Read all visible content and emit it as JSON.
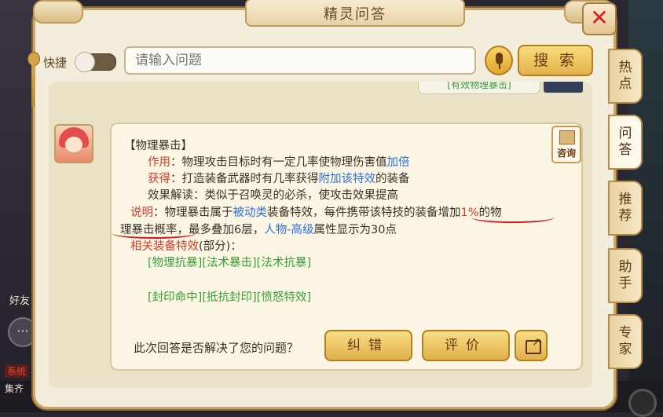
{
  "window": {
    "title": "精灵问答"
  },
  "background": {
    "friend_label": "好友",
    "chat_icon_text": "···",
    "system_tag": "系统",
    "gather_label": "集齐"
  },
  "toolbar": {
    "shortcut_label": "快捷",
    "search_placeholder": "请输入问题",
    "search_label": "搜 索"
  },
  "previous_message": {
    "text": "[有效物理暴击]"
  },
  "answer": {
    "title": "【物理暴击】",
    "effect_label": "作用",
    "effect_text": "：物理攻击目标时有一定几率使物理伤害值",
    "effect_link": "加倍",
    "obtain_label": "获得",
    "obtain_text": "：打造装备武器时有几率获得",
    "obtain_link": "附加该特效",
    "obtain_suffix": "的装备",
    "explain_text": "效果解读：类似于召唤灵的必杀，使攻击效果提高",
    "note_label": "说明",
    "note_text1": "：物理暴击属于",
    "note_link1": "被动类",
    "note_text2": "装备特效，每件携带该特技的装备增加",
    "note_percent": "1%",
    "note_text3": "的物",
    "note_line2_start": "理暴击概率",
    "note_text4": "，最多叠加6层，",
    "note_link2": "人物-高级",
    "note_text5": "属性显示为30点",
    "related_label": "相关装备特效",
    "related_suffix": "(部分)：",
    "related_row1": [
      "[物理抗暴]",
      "[法术暴击]",
      "[法术抗暴]"
    ],
    "related_row2": [
      "[封印命中]",
      "[抵抗封印]",
      "[愤怒特效]"
    ],
    "consult_label": "咨询"
  },
  "feedback": {
    "question": "此次回答是否解决了您的问题？",
    "correct_label": "纠错",
    "rate_label": "评价"
  },
  "tabs": [
    {
      "label": "热点"
    },
    {
      "label": "问答"
    },
    {
      "label": "推荐"
    },
    {
      "label": "助手"
    },
    {
      "label": "专家"
    }
  ],
  "colors": {
    "accent_red": "#d93a2a",
    "link_blue": "#2f6fd6",
    "effect_green": "#3a9c3a",
    "panel_bg": "#f3eedb"
  }
}
